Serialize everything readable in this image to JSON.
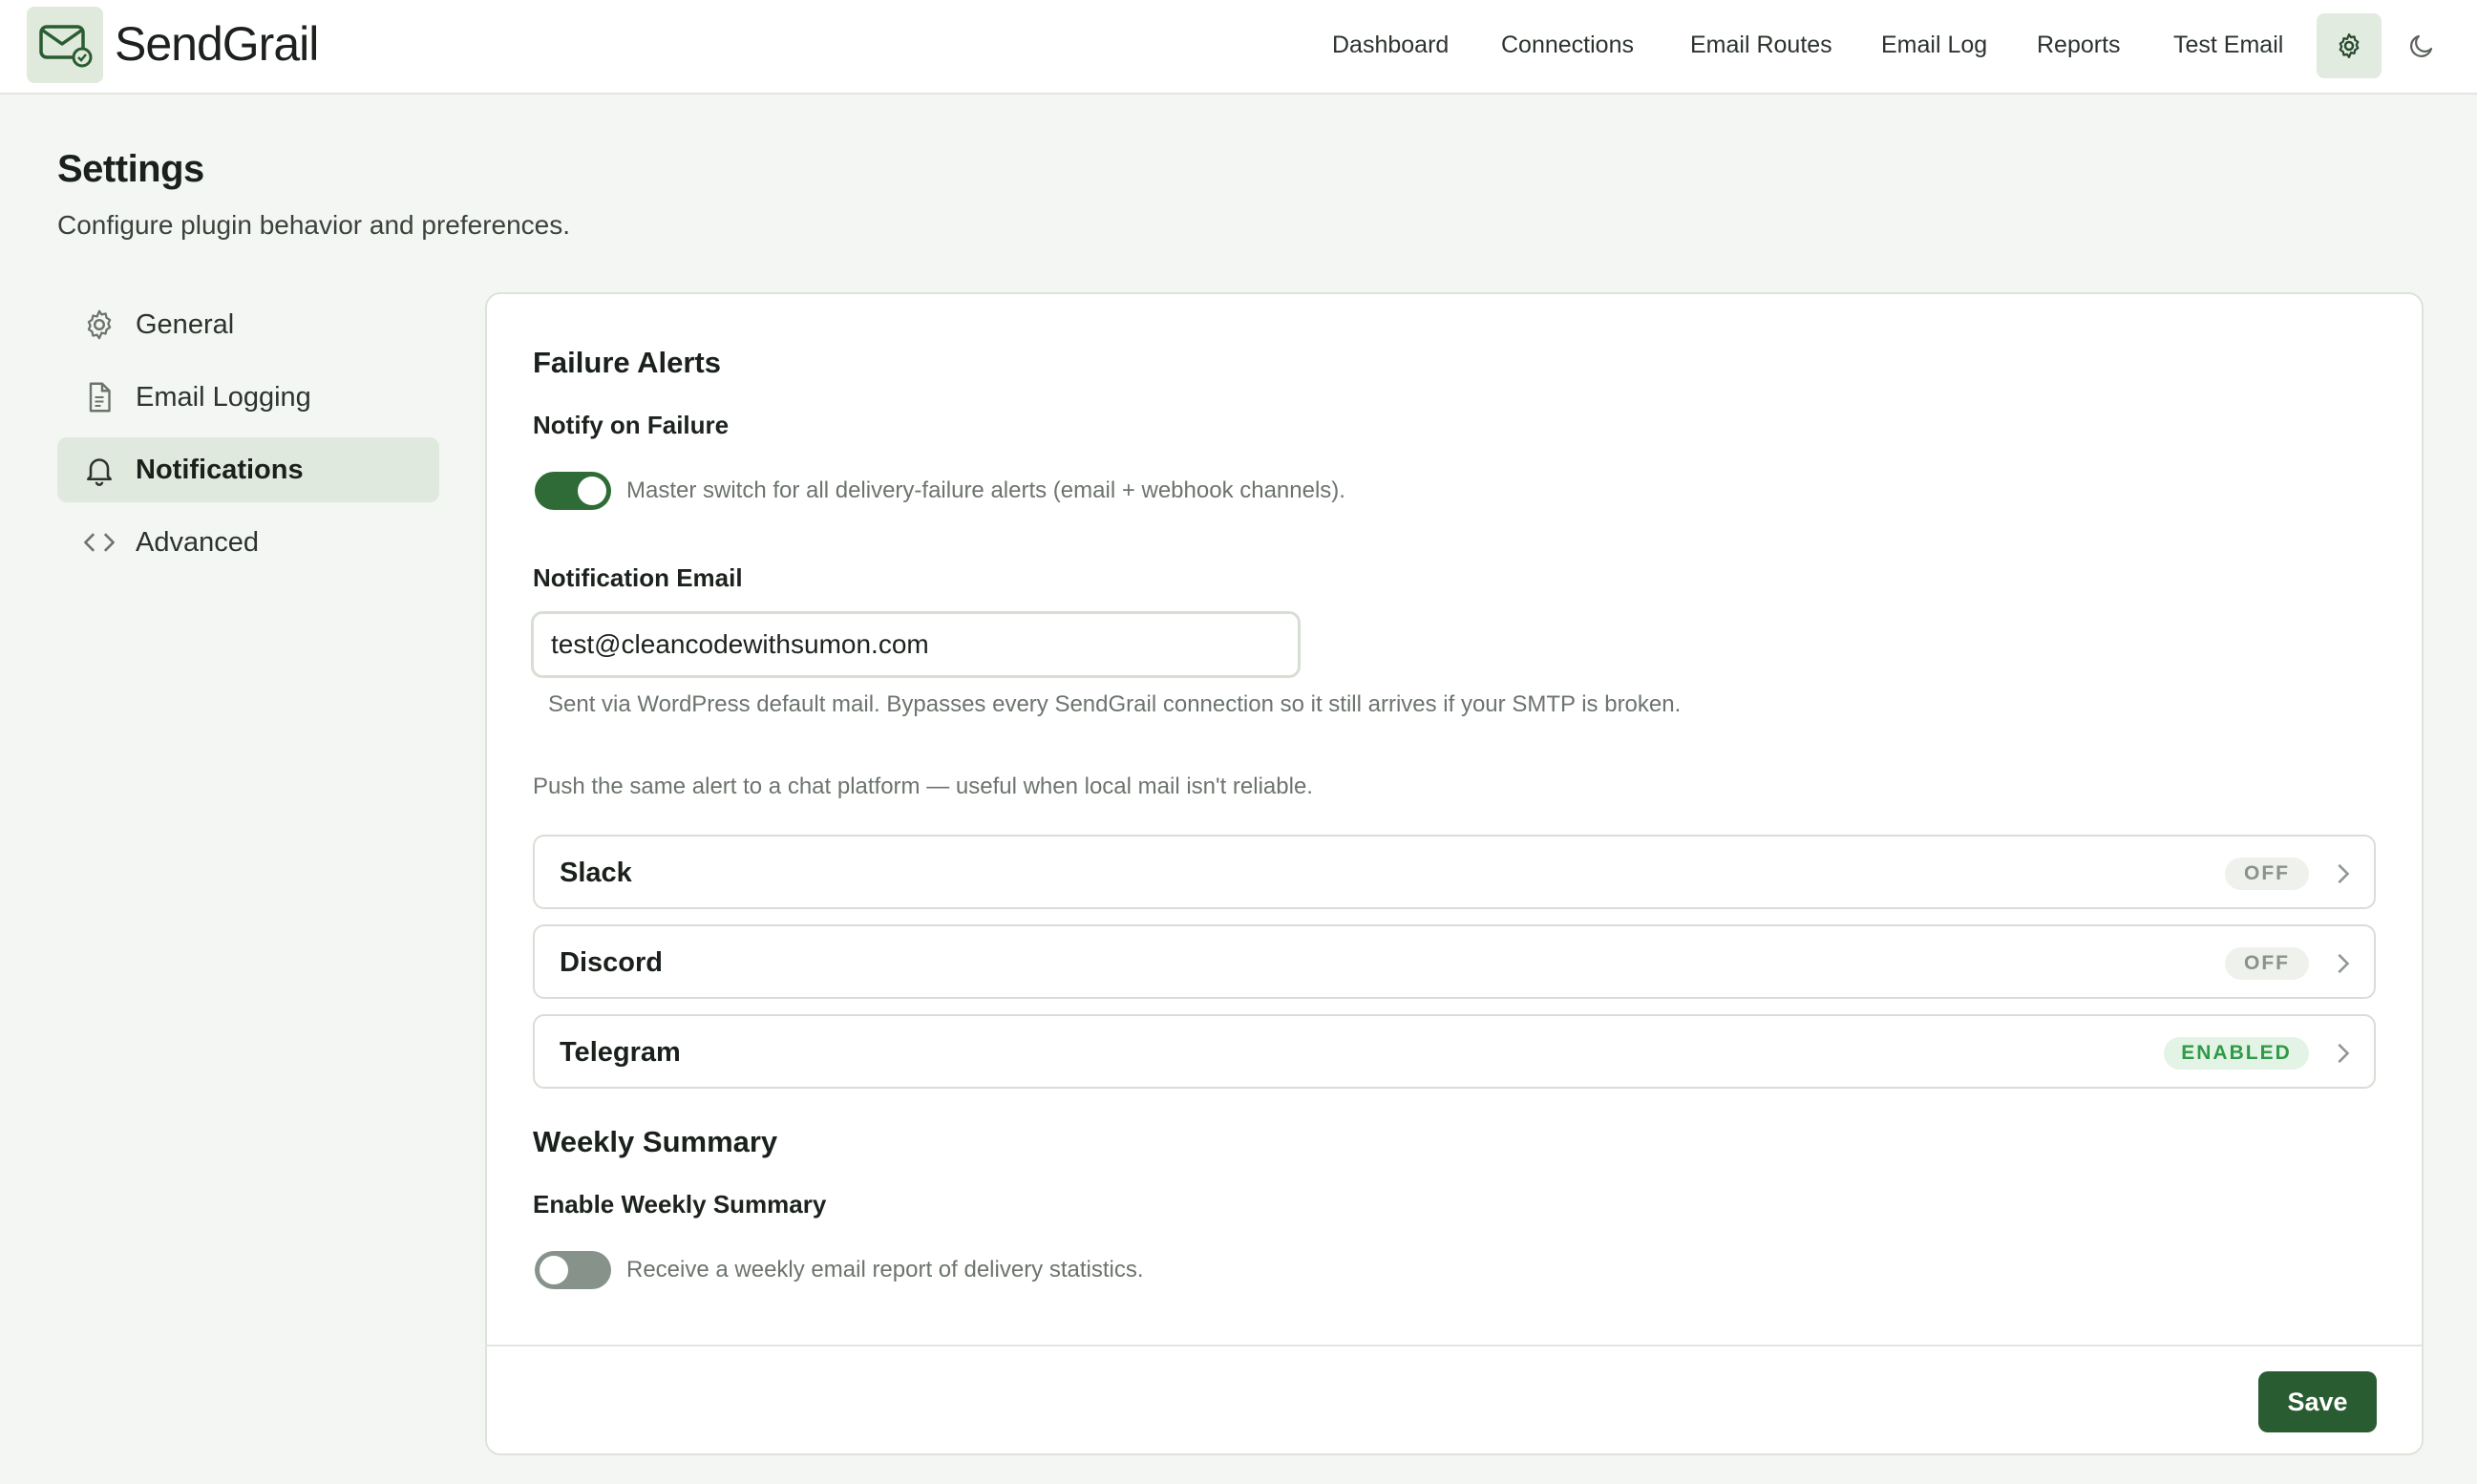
{
  "app": {
    "brand": "SendGrail",
    "logo_icon": "envelope-shield-icon"
  },
  "nav": {
    "links": [
      "Dashboard",
      "Connections",
      "Email Routes",
      "Email Log",
      "Reports",
      "Test Email"
    ],
    "settings_icon": "gear-icon",
    "theme_icon": "moon-icon"
  },
  "page": {
    "title": "Settings",
    "subtitle": "Configure plugin behavior and preferences."
  },
  "sidebar": {
    "items": [
      {
        "label": "General",
        "icon": "gear-icon",
        "active": false
      },
      {
        "label": "Email Logging",
        "icon": "document-icon",
        "active": false
      },
      {
        "label": "Notifications",
        "icon": "bell-icon",
        "active": true
      },
      {
        "label": "Advanced",
        "icon": "code-icon",
        "active": false
      }
    ]
  },
  "failure_alerts": {
    "heading": "Failure Alerts",
    "notify_label": "Notify on Failure",
    "notify_enabled": true,
    "notify_help": "Master switch for all delivery-failure alerts (email + webhook channels).",
    "email_label": "Notification Email",
    "email_value": "test@cleancodewithsumon.com",
    "email_help": "Sent via WordPress default mail. Bypasses every SendGrail connection so it still arrives if your SMTP is broken.",
    "channels_intro": "Push the same alert to a chat platform — useful when local mail isn't reliable.",
    "channels": [
      {
        "name": "Slack",
        "status": "OFF"
      },
      {
        "name": "Discord",
        "status": "OFF"
      },
      {
        "name": "Telegram",
        "status": "ENABLED"
      }
    ]
  },
  "weekly_summary": {
    "heading": "Weekly Summary",
    "enable_label": "Enable Weekly Summary",
    "enabled": false,
    "help": "Receive a weekly email report of delivery statistics."
  },
  "footer": {
    "save_label": "Save"
  },
  "colors": {
    "accent": "#2f6b37",
    "save": "#2a5c31",
    "enabled_badge": "#2f9a47"
  }
}
